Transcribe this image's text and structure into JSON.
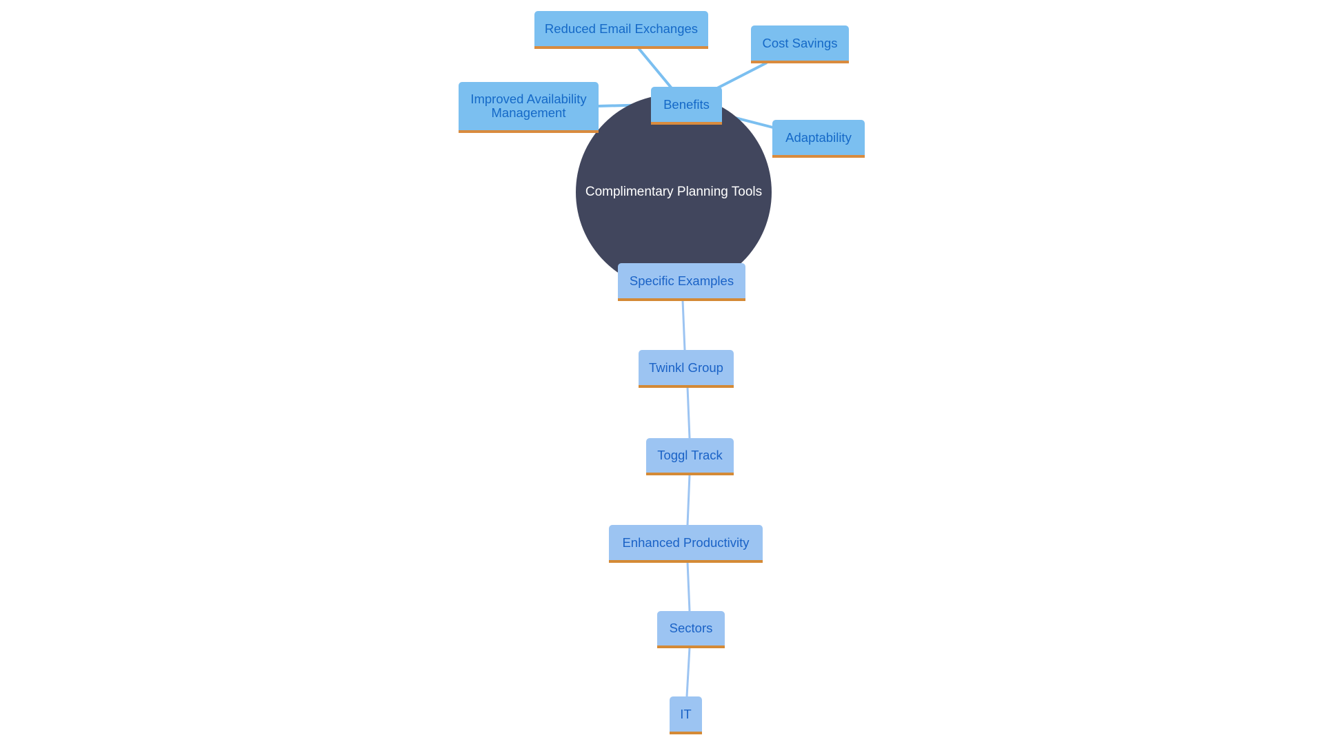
{
  "diagram": {
    "type": "mind-map",
    "root": {
      "label": "Complimentary Planning Tools"
    },
    "branches": [
      {
        "label": "Benefits",
        "children": [
          {
            "label": "Reduced Email Exchanges"
          },
          {
            "label": "Cost Savings"
          },
          {
            "label": "Improved Availability Management"
          },
          {
            "label": "Adaptability"
          }
        ]
      },
      {
        "label": "Specific Examples",
        "chain": [
          {
            "label": "Twinkl Group"
          },
          {
            "label": "Toggl Track"
          },
          {
            "label": "Enhanced Productivity"
          },
          {
            "label": "Sectors"
          },
          {
            "label": "IT"
          }
        ]
      }
    ],
    "colors": {
      "root_fill": "#41465d",
      "benefit_fill": "#7bbff0",
      "example_fill": "#9cc4f2",
      "node_text": "#1569c7",
      "node_underline": "#d98b3e",
      "benefit_edge": "#7bbff0",
      "example_edge": "#9cc4f2"
    }
  }
}
